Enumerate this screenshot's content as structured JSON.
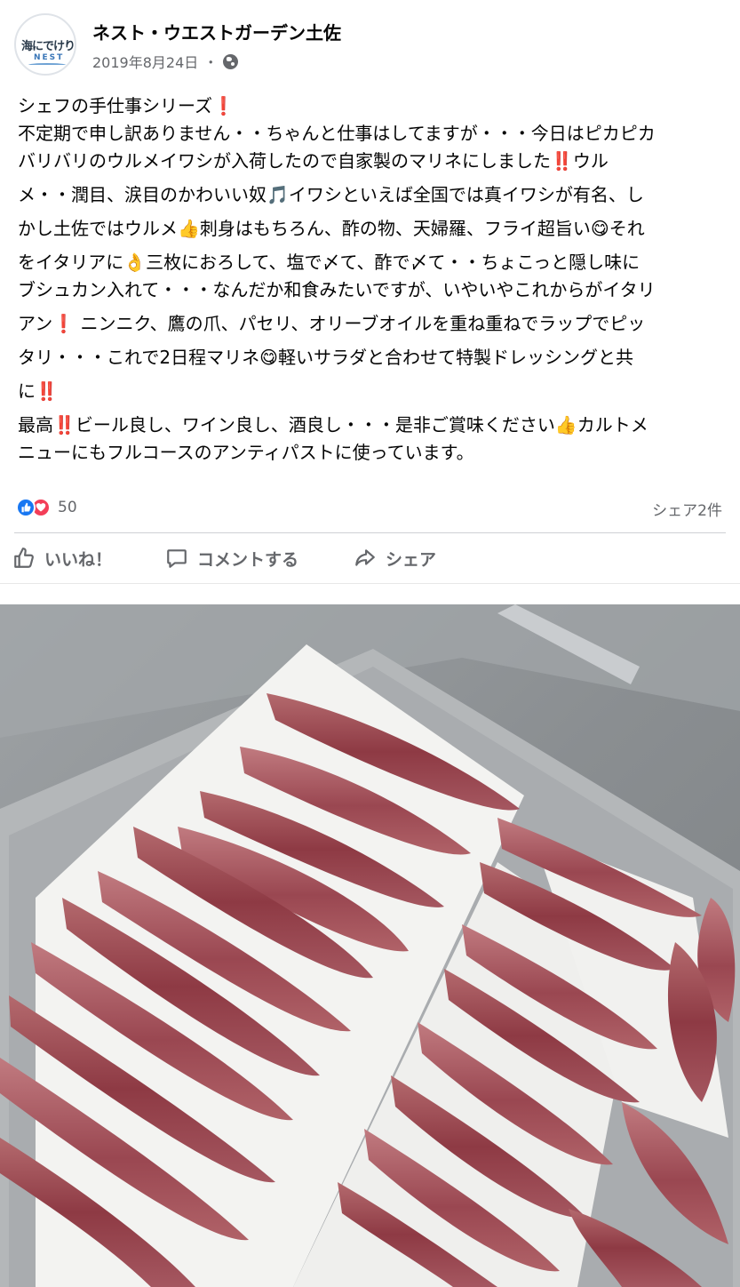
{
  "page": {
    "name": "ネスト・ウエストガーデン土佐",
    "date": "2019年8月24日",
    "separator": "・",
    "avatar_text": "海にでけります",
    "avatar_logo": "NEST"
  },
  "post": {
    "lines": [
      "シェフの手仕事シリーズ❗️",
      "不定期で申し訳ありません・・ちゃんと仕事はしてますが・・・今日はピカピカ",
      "バリバリのウルメイワシが入荷したので自家製のマリネにしました‼️ウル",
      "メ・・潤目、涙目のかわいい奴🎵イワシといえば全国では真イワシが有名、し",
      "かし土佐ではウルメ👍刺身はもちろん、酢の物、天婦羅、フライ超旨い😋それ",
      "をイタリアに👌三枚におろして、塩で〆て、酢で〆て・・ちょこっと隠し味に",
      "ブシュカン入れて・・・なんだか和食みたいですが、いやいやこれからがイタリ",
      "アン❗️ ニンニク、鷹の爪、パセリ、オリーブオイルを重ね重ねでラップでピッ",
      "タリ・・・これで2日程マリネ😋軽いサラダと合わせて特製ドレッシングと共",
      "に‼️",
      "最高‼️ビール良し、ワイン良し、酒良し・・・是非ご賞味ください👍カルトメ",
      "ニューにもフルコースのアンティパストに使っています。"
    ]
  },
  "stats": {
    "reaction_count": "50",
    "share_count": "シェア2件"
  },
  "actions": {
    "like": "いいね！",
    "comment": "コメントする",
    "share": "シェア"
  },
  "icons": {
    "like": "thumbs-up-icon",
    "comment": "speech-bubble-icon",
    "share": "share-arrow-icon",
    "privacy": "globe-icon"
  },
  "colors": {
    "like_blue": "#1877f2",
    "love_red": "#f33e58",
    "muted_text": "#65676b"
  }
}
